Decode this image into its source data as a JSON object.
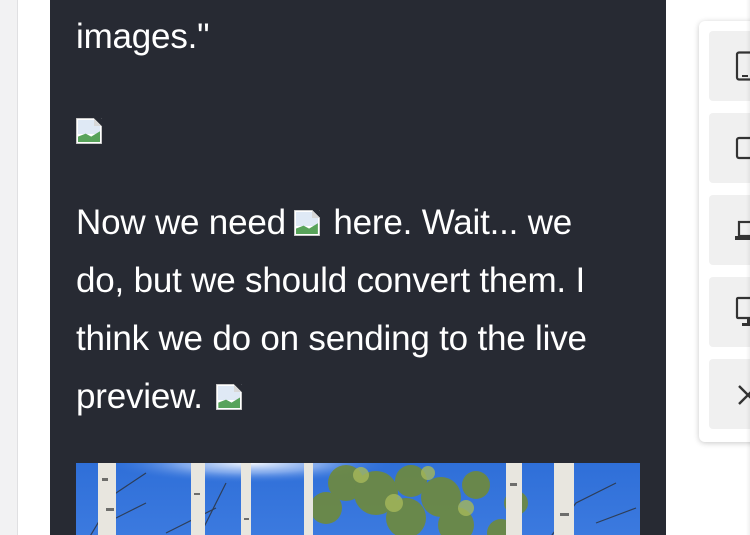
{
  "preview": {
    "paragraph_top": "images.\"",
    "paragraph_main": {
      "line1_before": "Now we need",
      "line1_after": "here. Wait... we",
      "line2": "do, but we should convert them. I",
      "line3": "think we do on sending to the live",
      "line4": "preview."
    },
    "photo_icon": "aspen-trees-photo"
  },
  "toolbar": {
    "buttons": [
      {
        "icon": "tablet-portrait-icon"
      },
      {
        "icon": "tablet-landscape-icon"
      },
      {
        "icon": "laptop-icon"
      },
      {
        "icon": "desktop-icon"
      },
      {
        "icon": "close-icon"
      }
    ]
  },
  "colors": {
    "preview_bg": "#272a33",
    "text": "#ffffff",
    "toolbar_button_bg": "#f0f0f0",
    "icon": "#333333"
  }
}
